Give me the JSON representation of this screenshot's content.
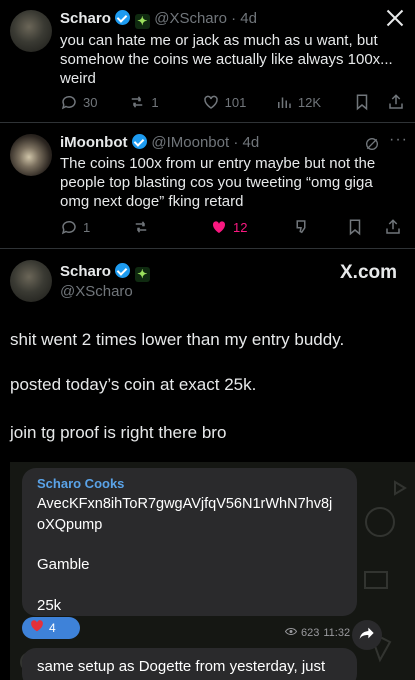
{
  "tweet1": {
    "name": "Scharo",
    "handle": "@XScharo · 4d",
    "text": "you can hate me or jack as much as u want, but somehow the coins we actually like always 100x... weird",
    "replies": "30",
    "retweets": "1",
    "likes": "101",
    "views": "12K",
    "badge_icon": "frog-badge-icon"
  },
  "tweet2": {
    "name": "iMoonbot",
    "handle": "@IMoonbot · 4d",
    "text": "The coins 100x from ur entry maybe but not the people top blasting cos you tweeting “omg giga omg next doge” fking retard",
    "replies": "1",
    "retweets": "",
    "likes": "12",
    "like_color": "#f91880"
  },
  "tweet3": {
    "name": "Scharo",
    "handle": "@XScharo",
    "source": "X.com",
    "lines": [
      "shit went 2 times lower than my entry buddy.",
      "posted today’s coin at exact 25k.",
      "join tg proof is right there bro"
    ]
  },
  "telegram": {
    "sender": "Scharo Cooks",
    "address_line1": "AvecKFxn8ihToR7gwgAVjfqV56N1rWhN7hv8j",
    "address_line2": "oXQpump",
    "word": "Gamble",
    "mcap": "25k",
    "reaction_count": "4",
    "views": "623",
    "time": "11:32",
    "next_message": "same setup as Dogette from yesterday, just"
  },
  "colors": {
    "accent": "#1d9bf0",
    "telegram_link": "#5aa3e8",
    "reaction_bg": "#3e82d9"
  }
}
